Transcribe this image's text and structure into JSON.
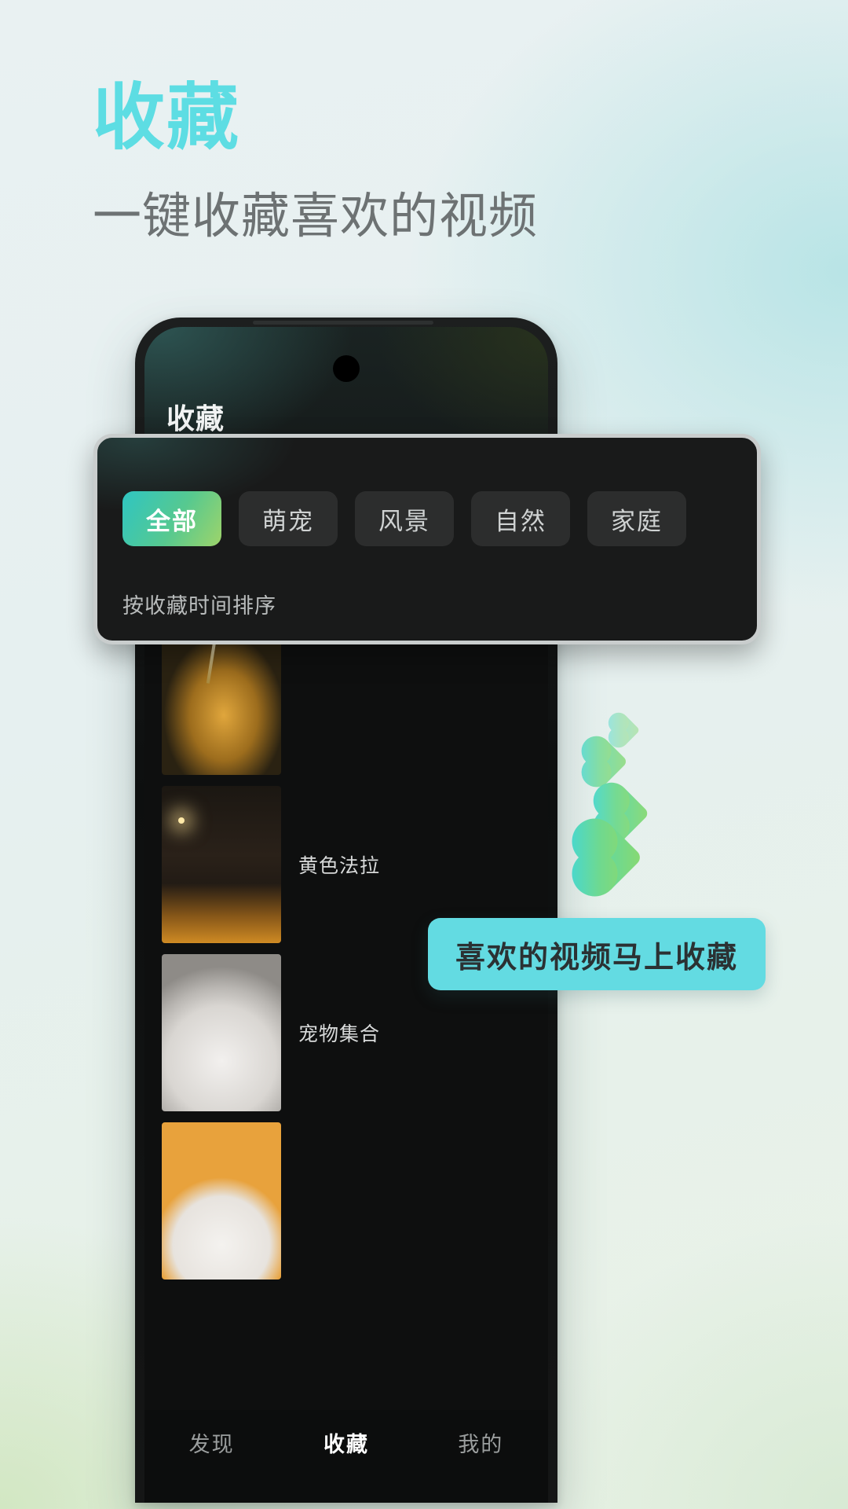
{
  "page": {
    "title": "收藏",
    "subtitle": "一键收藏喜欢的视频",
    "title_color": "#5ddde3",
    "subtitle_color": "#6d7273",
    "background_color": "#e8f0f0"
  },
  "phone": {
    "app_title": "收藏",
    "accent_color": "#63dbe2"
  },
  "filter_panel": {
    "chips": [
      {
        "label": "全部",
        "active": true
      },
      {
        "label": "萌宠",
        "active": false
      },
      {
        "label": "风景",
        "active": false
      },
      {
        "label": "自然",
        "active": false
      },
      {
        "label": "家庭",
        "active": false
      }
    ],
    "sort_label": "按收藏时间排序",
    "active_chip_gradient": [
      "#2fc5c2",
      "#9ed46a"
    ],
    "border_color": "#c9cdcd"
  },
  "list": {
    "items": [
      {
        "label": "",
        "thumb": "eiffel-tower-thumbnail"
      },
      {
        "label": "黄色法拉",
        "thumb": "city-night-thumbnail"
      },
      {
        "label": "宠物集合",
        "thumb": "white-cat-thumbnail"
      },
      {
        "label": "",
        "thumb": "white-dog-thumbnail"
      }
    ]
  },
  "tooltip": {
    "text": "喜欢的视频马上收藏",
    "background_color": "#63dbe2",
    "text_color": "#2b3133"
  },
  "hearts": {
    "icon": "heart-icon",
    "count": 4,
    "gradient": [
      "#3fd8df",
      "#8ad96f"
    ]
  },
  "bottom_nav": {
    "items": [
      {
        "label": "发现",
        "active": false
      },
      {
        "label": "收藏",
        "active": true
      },
      {
        "label": "我的",
        "active": false
      }
    ]
  }
}
